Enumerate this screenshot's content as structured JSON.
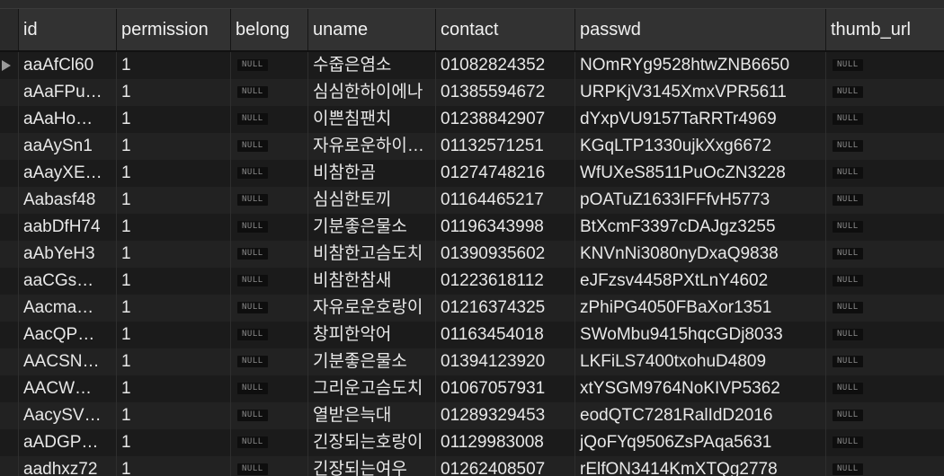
{
  "columns": {
    "id": "id",
    "permission": "permission",
    "belong": "belong",
    "uname": "uname",
    "contact": "contact",
    "passwd": "passwd",
    "thumb_url": "thumb_url"
  },
  "null_label": "NULL",
  "rows": [
    {
      "id": "aaAfCl60",
      "permission": "1",
      "belong": "NULL",
      "uname": "수줍은염소",
      "contact": "01082824352",
      "passwd": "NOmRYg9528htwZNB6650",
      "thumb_url": "NULL",
      "selected": true
    },
    {
      "id": "aAaFPu…",
      "permission": "1",
      "belong": "NULL",
      "uname": "심심한하이에나",
      "contact": "01385594672",
      "passwd": "URPKjV3145XmxVPR5611",
      "thumb_url": "NULL"
    },
    {
      "id": "aAaHo…",
      "permission": "1",
      "belong": "NULL",
      "uname": "이쁜침팬치",
      "contact": "01238842907",
      "passwd": "dYxpVU9157TaRRTr4969",
      "thumb_url": "NULL"
    },
    {
      "id": "aaAySn1",
      "permission": "1",
      "belong": "NULL",
      "uname": "자유로운하이…",
      "contact": "01132571251",
      "passwd": "KGqLTP1330ujkXxg6672",
      "thumb_url": "NULL"
    },
    {
      "id": "aAayXE…",
      "permission": "1",
      "belong": "NULL",
      "uname": "비참한곰",
      "contact": "01274748216",
      "passwd": "WfUXeS8511PuOcZN3228",
      "thumb_url": "NULL"
    },
    {
      "id": "Aabasf48",
      "permission": "1",
      "belong": "NULL",
      "uname": "심심한토끼",
      "contact": "01164465217",
      "passwd": "pOATuZ1633IFFfvH5773",
      "thumb_url": "NULL"
    },
    {
      "id": "aabDfH74",
      "permission": "1",
      "belong": "NULL",
      "uname": "기분좋은물소",
      "contact": "01196343998",
      "passwd": "BtXcmF3397cDAJgz3255",
      "thumb_url": "NULL"
    },
    {
      "id": "aAbYeH3",
      "permission": "1",
      "belong": "NULL",
      "uname": "비참한고슴도치",
      "contact": "01390935602",
      "passwd": "KNVnNi3080nyDxaQ9838",
      "thumb_url": "NULL"
    },
    {
      "id": "aaCGs…",
      "permission": "1",
      "belong": "NULL",
      "uname": "비참한참새",
      "contact": "01223618112",
      "passwd": "eJFzsv4458PXtLnY4602",
      "thumb_url": "NULL"
    },
    {
      "id": "Aacma…",
      "permission": "1",
      "belong": "NULL",
      "uname": "자유로운호랑이",
      "contact": "01216374325",
      "passwd": "zPhiPG4050FBaXor1351",
      "thumb_url": "NULL"
    },
    {
      "id": "AacQP…",
      "permission": "1",
      "belong": "NULL",
      "uname": "창피한악어",
      "contact": "01163454018",
      "passwd": "SWoMbu9415hqcGDj8033",
      "thumb_url": "NULL"
    },
    {
      "id": "AACSN…",
      "permission": "1",
      "belong": "NULL",
      "uname": "기분좋은물소",
      "contact": "01394123920",
      "passwd": "LKFiLS7400txohuD4809",
      "thumb_url": "NULL"
    },
    {
      "id": "AACW…",
      "permission": "1",
      "belong": "NULL",
      "uname": "그리운고슴도치",
      "contact": "01067057931",
      "passwd": "xtYSGM9764NoKIVP5362",
      "thumb_url": "NULL"
    },
    {
      "id": "AacySV…",
      "permission": "1",
      "belong": "NULL",
      "uname": "열받은늑대",
      "contact": "01289329453",
      "passwd": "eodQTC7281RalIdD2016",
      "thumb_url": "NULL"
    },
    {
      "id": "aADGP…",
      "permission": "1",
      "belong": "NULL",
      "uname": "긴장되는호랑이",
      "contact": "01129983008",
      "passwd": "jQoFYq9506ZsPAqa5631",
      "thumb_url": "NULL"
    },
    {
      "id": "aadhxz72",
      "permission": "1",
      "belong": "NULL",
      "uname": "긴장되는여우",
      "contact": "01262408507",
      "passwd": "rElfON3414KmXTQg2778",
      "thumb_url": "NULL"
    }
  ]
}
